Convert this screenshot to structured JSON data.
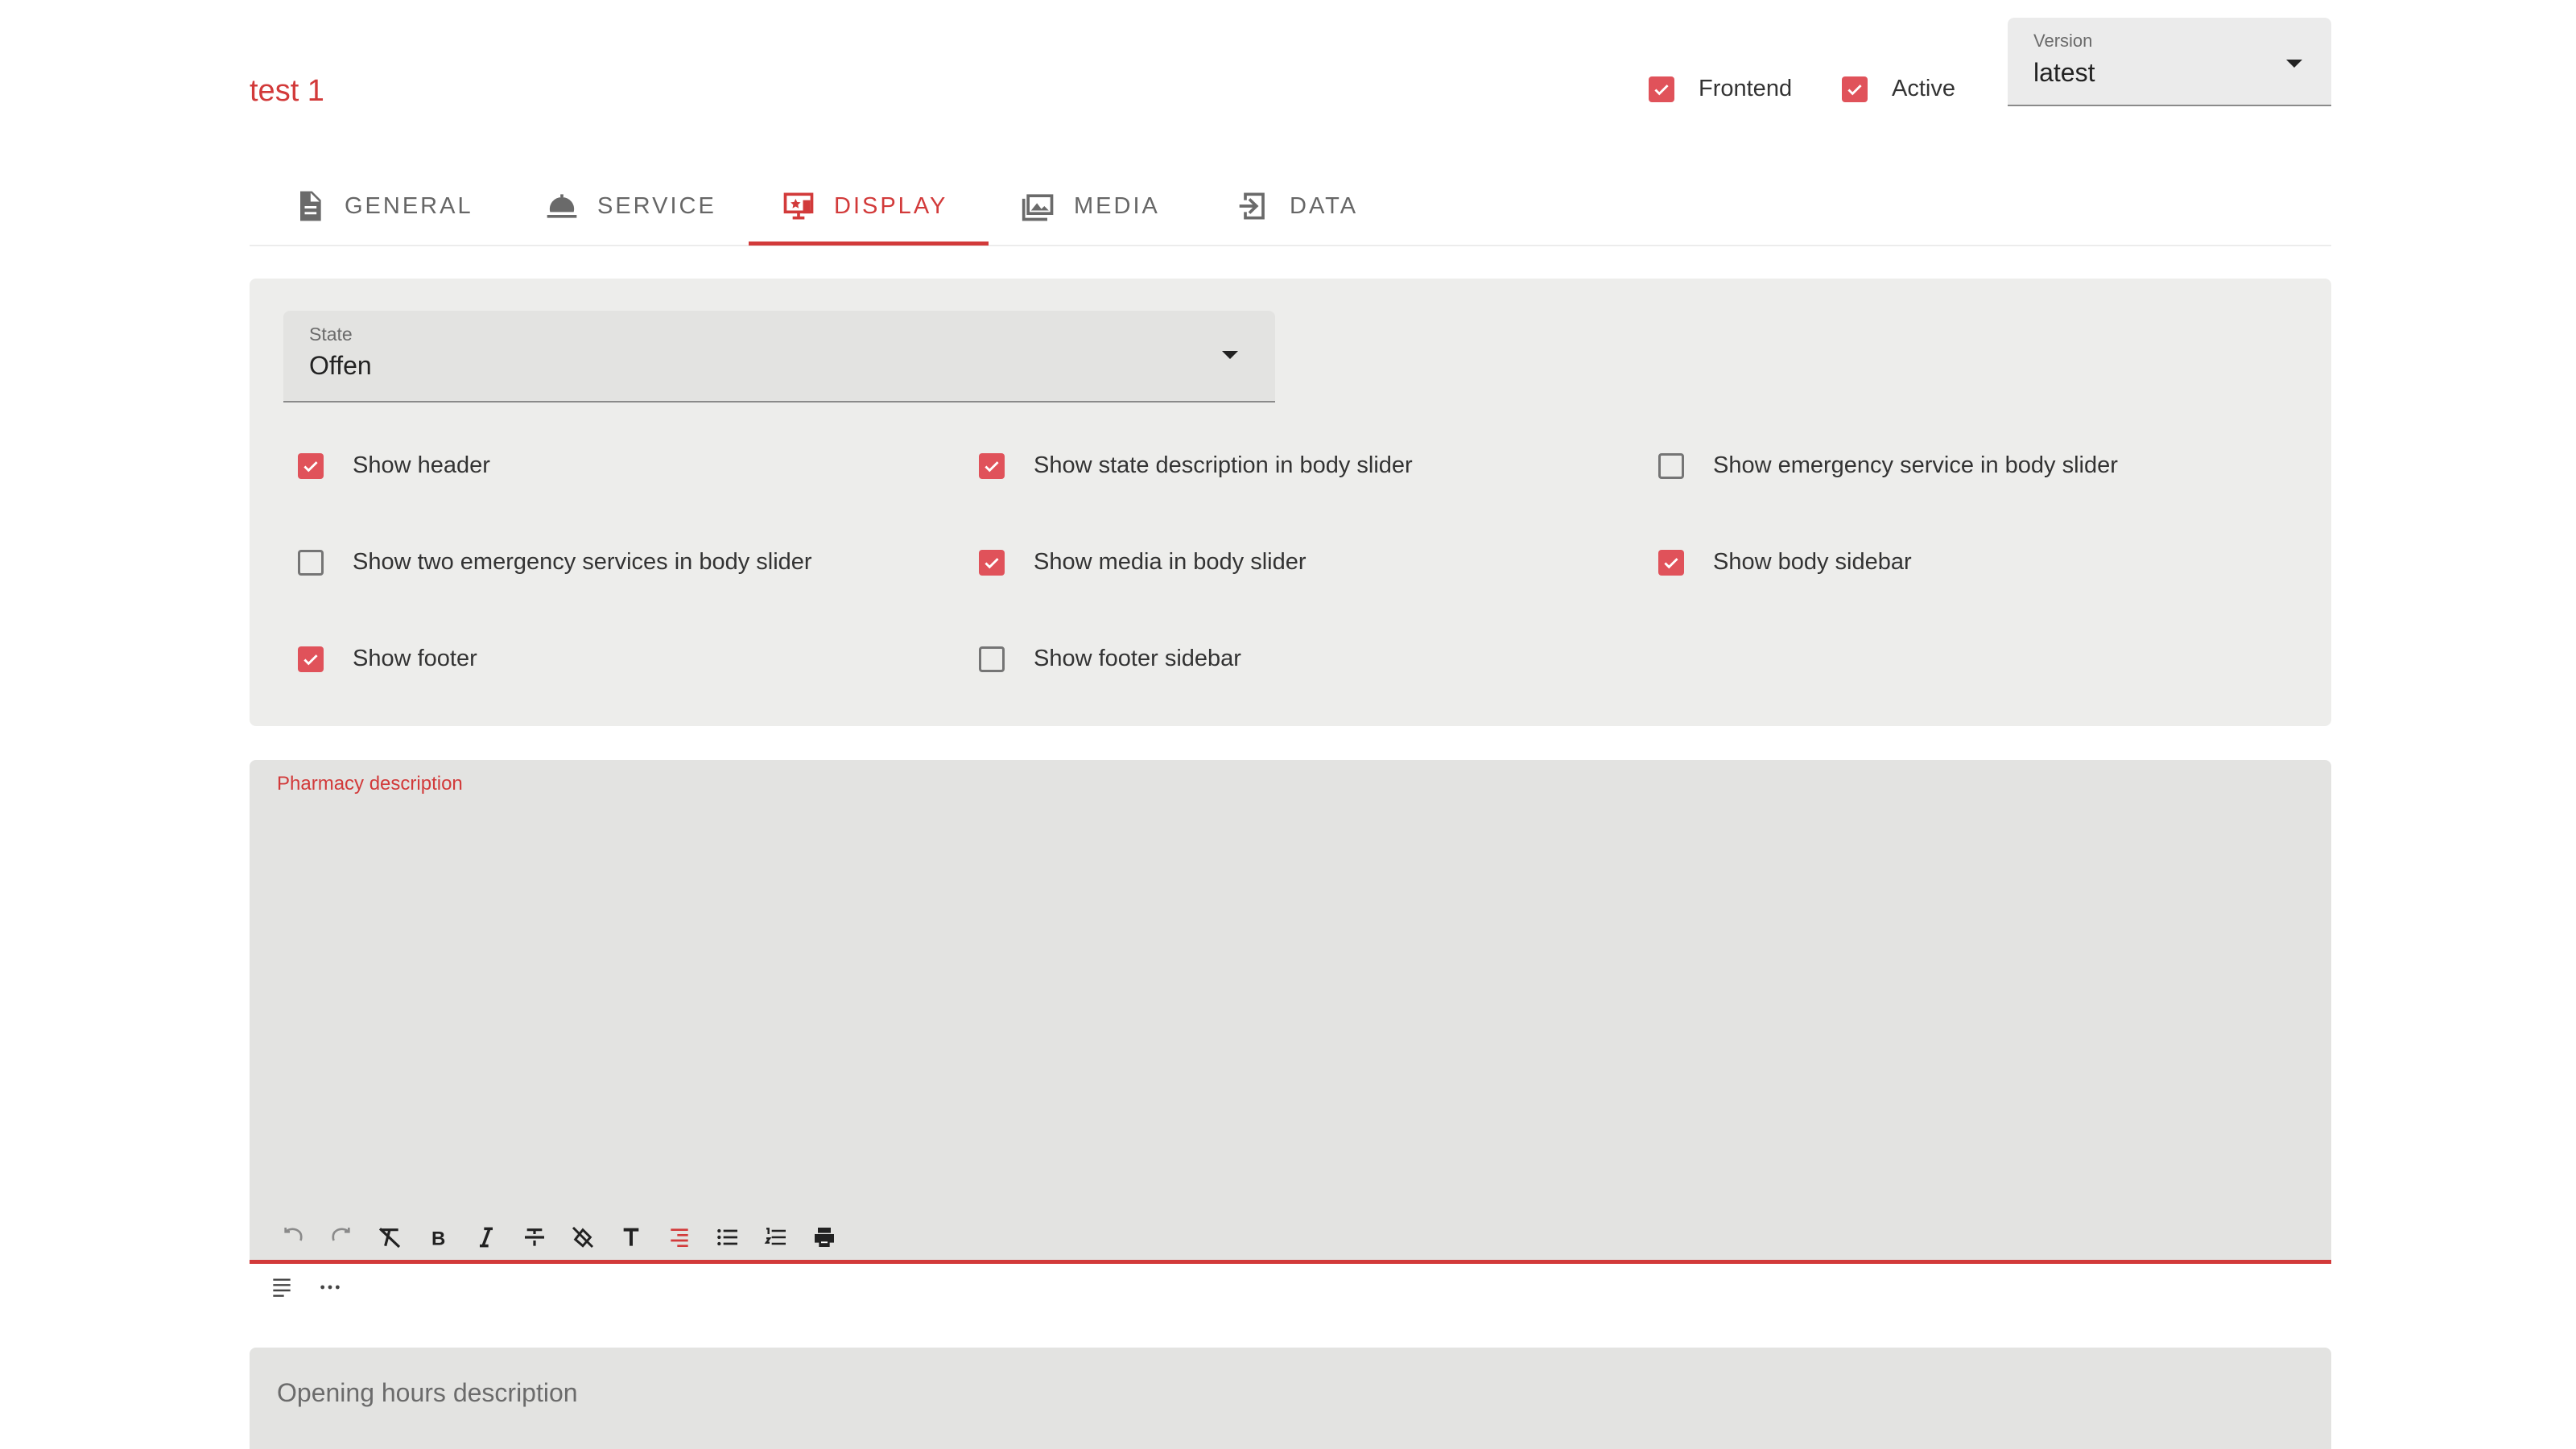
{
  "header": {
    "title": "test 1",
    "frontend": {
      "label": "Frontend",
      "checked": true
    },
    "active": {
      "label": "Active",
      "checked": true
    },
    "version": {
      "label": "Version",
      "value": "latest"
    }
  },
  "tabs": [
    {
      "label": "GENERAL",
      "icon": "document-icon",
      "active": false
    },
    {
      "label": "SERVICE",
      "icon": "service-bell-icon",
      "active": false
    },
    {
      "label": "DISPLAY",
      "icon": "monitor-star-icon",
      "active": true
    },
    {
      "label": "MEDIA",
      "icon": "images-icon",
      "active": false
    },
    {
      "label": "DATA",
      "icon": "import-icon",
      "active": false
    }
  ],
  "display": {
    "state": {
      "label": "State",
      "value": "Offen"
    },
    "options": [
      {
        "label": "Show header",
        "checked": true
      },
      {
        "label": "Show state description in body slider",
        "checked": true
      },
      {
        "label": "Show emergency service in body slider",
        "checked": false
      },
      {
        "label": "Show two emergency services in body slider",
        "checked": false
      },
      {
        "label": "Show media in body slider",
        "checked": true
      },
      {
        "label": "Show body sidebar",
        "checked": true
      },
      {
        "label": "Show footer",
        "checked": true
      },
      {
        "label": "Show footer sidebar",
        "checked": false
      }
    ]
  },
  "editor": {
    "label": "Pharmacy description",
    "toolbar": [
      "undo-icon",
      "redo-icon",
      "clear-format-icon",
      "bold-icon",
      "italic-icon",
      "strikethrough-icon",
      "clear-highlight-icon",
      "text-size-icon",
      "align-right-icon",
      "bullet-list-icon",
      "numbered-list-icon",
      "print-icon"
    ],
    "toolbar_secondary": [
      "paragraph-icon",
      "more-icon"
    ]
  },
  "opening_hours": {
    "placeholder": "Opening hours description"
  },
  "colors": {
    "accent": "#d23a3a",
    "checkbox": "#e0525a",
    "field_bg": "#e3e3e1",
    "panel_bg": "#ededeb"
  }
}
